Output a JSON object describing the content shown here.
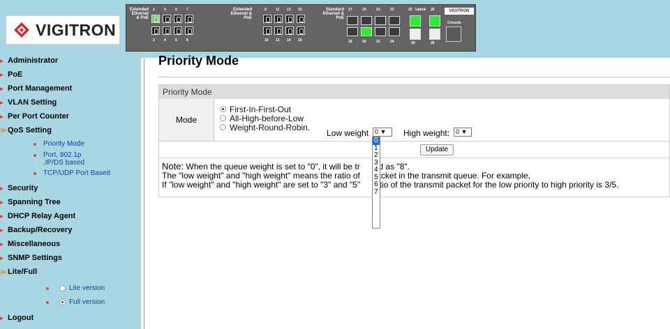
{
  "header": {
    "logo_text": "VIGITRON",
    "panel": {
      "label_extended_1": "Extended Ethernet & PoE",
      "label_extended_2": "Extended Ethernet & PoE",
      "label_standard": "Standard Ethernet & PoE",
      "brand": "VIGITRON",
      "uplink_label": "Uplink",
      "console_label": "Console",
      "top_numbers_1": [
        "1",
        "3",
        "5",
        "7"
      ],
      "bottom_numbers_1": [
        "2",
        "4",
        "6",
        "8"
      ],
      "top_numbers_2": [
        "9",
        "11",
        "13",
        "15"
      ],
      "bottom_numbers_2": [
        "10",
        "12",
        "14",
        "16"
      ],
      "top_numbers_3": [
        "17",
        "19",
        "21",
        "23"
      ],
      "bottom_numbers_3": [
        "18",
        "20",
        "22",
        "24"
      ],
      "top_numbers_4": [
        "25",
        "26"
      ],
      "bottom_numbers_4": [
        "26",
        "26"
      ]
    }
  },
  "sidebar": {
    "items": [
      {
        "label": "Administrator"
      },
      {
        "label": "PoE"
      },
      {
        "label": "Port Management"
      },
      {
        "label": "VLAN Setting"
      },
      {
        "label": "Per Port Counter"
      },
      {
        "label": "QoS Setting"
      },
      {
        "label": "Security"
      },
      {
        "label": "Spanning Tree"
      },
      {
        "label": "DHCP Relay Agent"
      },
      {
        "label": "Backup/Recovery"
      },
      {
        "label": "Miscellaneous"
      },
      {
        "label": "SNMP Settings"
      },
      {
        "label": "Lite/Full"
      },
      {
        "label": "Logout"
      }
    ],
    "qos_subitems": [
      {
        "label": "Priority Mode"
      },
      {
        "label": "Port, 802.1p ,IP/DS based"
      },
      {
        "label": "TCP/UDP Port Based"
      }
    ],
    "versions": [
      {
        "label": "Lite version",
        "checked": false
      },
      {
        "label": "Full version",
        "checked": true
      }
    ]
  },
  "main": {
    "page_title": "Priority Mode",
    "box_title": "Priority Mode",
    "mode_label": "Mode",
    "options": [
      {
        "label": "First-In-First-Out",
        "checked": true
      },
      {
        "label": "All-High-before-Low",
        "checked": false
      },
      {
        "label": "Weight-Round-Robin.",
        "checked": false
      }
    ],
    "low_weight_label": "Low weight",
    "low_weight_value": "0",
    "high_weight_label": "High weight:",
    "high_weight_value": "0",
    "update_label": "Update",
    "note_title": "Note:",
    "note_line1": "When the queue weight is set to \"0\", it will be tr",
    "note_line1b": "ed as \"8\".",
    "note_line2": "The \"low weight\" and \"high weight\" means the ratio of",
    "note_line2b": "packet in the transmit queue. For example,",
    "note_line3": "If \"low weight\" and \"high weight\" are set to \"3\" and \"5\"",
    "note_line3b": "ratio of the transmit packet for the low priority to high priority is 3/5."
  },
  "dropdown": {
    "options": [
      "0",
      "1",
      "2",
      "3",
      "4",
      "5",
      "6",
      "7"
    ],
    "selected_index": 0
  },
  "colors": {
    "sidebar_bg": "#a8d6e2",
    "link_blue": "#1a3a9e",
    "selected_blue": "#1e6fd9"
  }
}
